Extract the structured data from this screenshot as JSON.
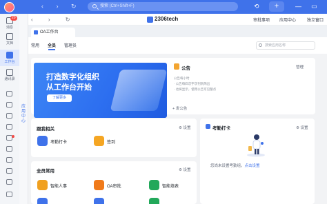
{
  "topbar": {
    "search_placeholder": "搜索 (Ctrl+Shift+F)",
    "badge_count": "20"
  },
  "rail": {
    "items": [
      {
        "label": "消息",
        "badge": "20"
      },
      {
        "label": "文档"
      },
      {
        "label": "工作台"
      },
      {
        "label": "通讯录"
      }
    ],
    "sub_label": "应用中心"
  },
  "header": {
    "org_name": "2306tech",
    "links": [
      "审批事项",
      "应用中心",
      "独立窗口"
    ]
  },
  "app_tab": {
    "label": "OA工作台"
  },
  "subtabs": [
    "常用",
    "全员",
    "管理员"
  ],
  "app_search_placeholder": "搜索应用名称",
  "banner": {
    "line1": "打造数字化组织",
    "line2": "从工作台开始",
    "button": "了解更多"
  },
  "announcement": {
    "title": "公告",
    "manage": "管理",
    "lines": [
      "公告每小时",
      "· 公告每四次字次刊到简出",
      "· 也将显示，使用公告可见整点"
    ],
    "post": "发公告"
  },
  "section_personal": {
    "title": "跟我相关",
    "settings": "设置",
    "apps": [
      "考勤打卡",
      "签到"
    ]
  },
  "section_attendance": {
    "title": "考勤打卡",
    "settings": "设置",
    "empty_text": "您尚未设置考勤组，",
    "empty_link": "点击设置"
  },
  "section_all": {
    "title": "全员常用",
    "settings": "设置",
    "apps": [
      "智能人事",
      "OA审批",
      "智能填表"
    ]
  },
  "colors": {
    "brand": "#3f72ea",
    "attendance_icon": "#3f72ea",
    "checkin_icon": "#f5a623",
    "hr_icon": "#f0a020",
    "oa_icon": "#f07a1a",
    "form_icon": "#22a85a"
  }
}
